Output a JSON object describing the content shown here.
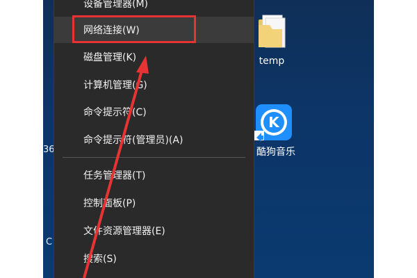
{
  "menu": {
    "items": [
      {
        "id": "device-manager",
        "label": "设备管理器(M)"
      },
      {
        "id": "network-connections",
        "label": "网络连接(W)"
      },
      {
        "id": "disk-management",
        "label": "磁盘管理(K)"
      },
      {
        "id": "computer-management",
        "label": "计算机管理(G)"
      },
      {
        "id": "command-prompt",
        "label": "命令提示符(C)"
      },
      {
        "id": "command-prompt-admin",
        "label": "命令提示符(管理员)(A)"
      },
      {
        "id": "task-manager",
        "label": "任务管理器(T)"
      },
      {
        "id": "control-panel",
        "label": "控制面板(P)"
      },
      {
        "id": "file-explorer",
        "label": "文件资源管理器(E)"
      },
      {
        "id": "search",
        "label": "搜索(S)"
      }
    ]
  },
  "desktop": {
    "icons": [
      {
        "label": "temp",
        "icon": "folder-icon"
      },
      {
        "label": "酷狗音乐",
        "icon": "kugou-icon"
      }
    ],
    "partial_labels": {
      "left_a": "36",
      "left_b": "C"
    }
  },
  "colors": {
    "highlight": "#e63434",
    "menu_bg": "#2a2a2a",
    "kugou_blue": "#1f8fff"
  }
}
